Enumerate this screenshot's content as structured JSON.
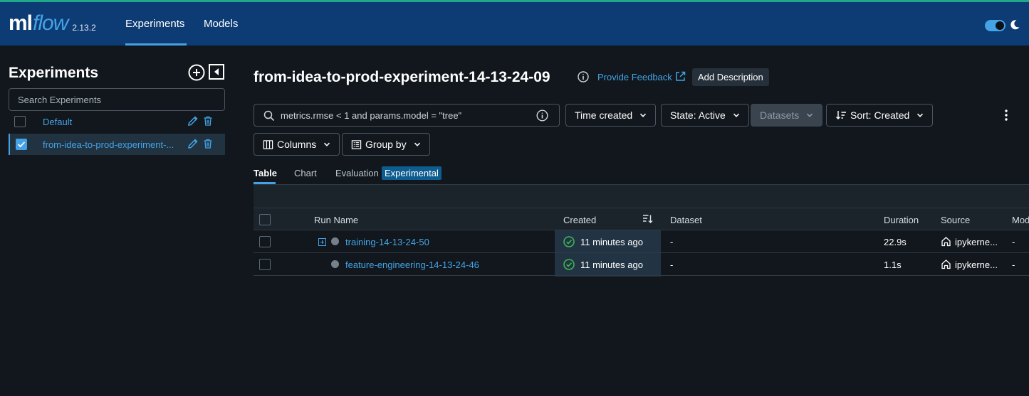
{
  "header": {
    "logo_ml": "ml",
    "logo_flow": "flow",
    "version": "2.13.2",
    "nav": [
      "Experiments",
      "Models"
    ],
    "active_nav": "Experiments",
    "theme_toggle": "dark"
  },
  "sidebar": {
    "title": "Experiments",
    "search_placeholder": "Search Experiments",
    "experiments": [
      {
        "name": "Default",
        "checked": false
      },
      {
        "name": "from-idea-to-prod-experiment-...",
        "checked": true
      }
    ]
  },
  "main": {
    "title": "from-idea-to-prod-experiment-14-13-24-09",
    "feedback_link": "Provide Feedback",
    "add_description": "Add Description",
    "filter_query": "metrics.rmse < 1 and params.model = \"tree\"",
    "controls": {
      "time_created": "Time created",
      "state": "State: Active",
      "datasets": "Datasets",
      "sort": "Sort: Created",
      "columns": "Columns",
      "group_by": "Group by"
    },
    "tabs": [
      "Table",
      "Chart",
      "Evaluation"
    ],
    "active_tab": "Table",
    "evaluation_badge": "Experimental",
    "table": {
      "columns": [
        "Run Name",
        "Created",
        "Dataset",
        "Duration",
        "Source",
        "Mod"
      ],
      "rows": [
        {
          "run_name": "training-14-13-24-50",
          "created": "11 minutes ago",
          "dataset": "-",
          "duration": "22.9s",
          "source": "ipykerne...",
          "model": "-"
        },
        {
          "run_name": "feature-engineering-14-13-24-46",
          "created": "11 minutes ago",
          "dataset": "-",
          "duration": "1.1s",
          "source": "ipykerne...",
          "model": "-"
        }
      ]
    }
  },
  "colors": {
    "header_bg": "#0d3b73",
    "accent": "#43a3e6",
    "page_bg": "#11171c",
    "success": "#3fb950"
  }
}
